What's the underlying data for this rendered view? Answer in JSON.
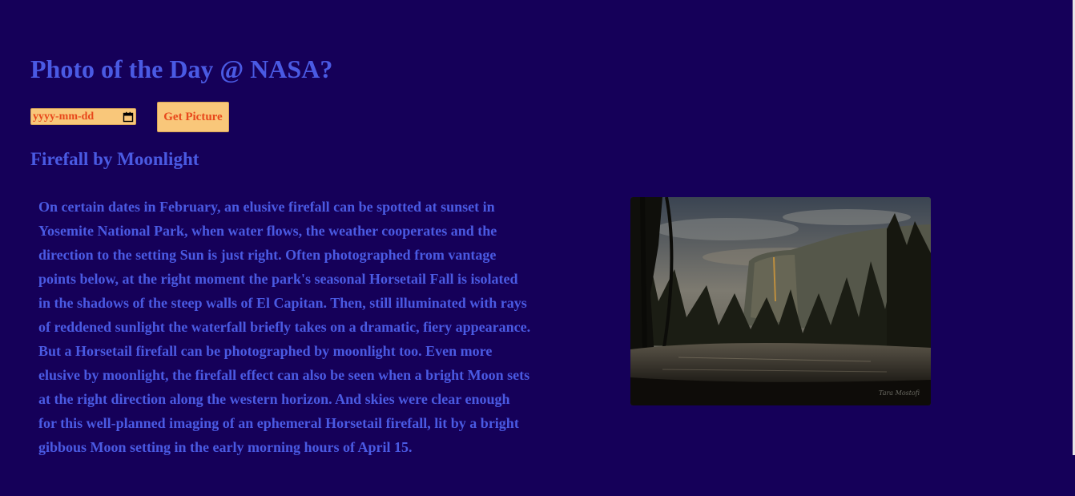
{
  "header": {
    "title": "Photo of the Day @ NASA?"
  },
  "controls": {
    "date_placeholder": "yyyy-mm-dd",
    "get_picture_label": "Get Picture"
  },
  "apod": {
    "title": "Firefall by Moonlight",
    "explanation": "On certain dates in February, an elusive firefall can be spotted at sunset in Yosemite National Park, when water flows, the weather cooperates and the direction to the setting Sun is just right. Often photographed from vantage points below, at the right moment the park's seasonal Horsetail Fall is isolated in the shadows of the steep walls of El Capitan. Then, still illuminated with rays of reddened sunlight the waterfall briefly takes on a dramatic, fiery appearance. But a Horsetail firefall can be photographed by moonlight too. Even more elusive by moonlight, the firefall effect can also be seen when a bright Moon sets at the right direction along the western horizon. And skies were clear enough for this well-planned imaging of an ephemeral Horsetail firefall, lit by a bright gibbous Moon setting in the early morning hours of April 15.",
    "photo_credit": "Tara Mostofi"
  },
  "colors": {
    "background": "#150059",
    "text_accent": "#4a5ae3",
    "button_bg": "#f9c77a",
    "button_text": "#e8481b"
  }
}
